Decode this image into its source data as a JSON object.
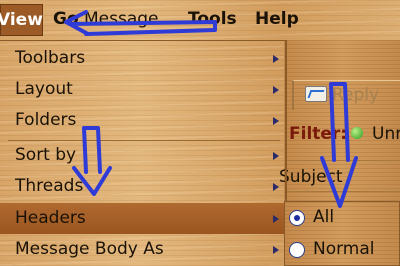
{
  "menubar": {
    "view": "View",
    "go": "Go",
    "message": "Message",
    "tools": "Tools",
    "help": "Help"
  },
  "view_menu": {
    "items": [
      {
        "label": "Toolbars",
        "has_submenu": true
      },
      {
        "label": "Layout",
        "has_submenu": true
      },
      {
        "label": "Folders",
        "has_submenu": true
      },
      {
        "label": "Sort by",
        "has_submenu": true
      },
      {
        "label": "Threads",
        "has_submenu": true
      },
      {
        "label": "Headers",
        "has_submenu": true,
        "highlighted": true
      },
      {
        "label": "Message Body As",
        "has_submenu": true
      }
    ]
  },
  "headers_submenu": {
    "options": [
      {
        "label": "All",
        "selected": true
      },
      {
        "label": "Normal",
        "selected": false
      }
    ]
  },
  "mail_window": {
    "reply_label": "Reply",
    "filter_label": "Filter:",
    "filter_value": "Unr",
    "subject_column": "Subject"
  },
  "annotation_color": "#2f3bd6"
}
